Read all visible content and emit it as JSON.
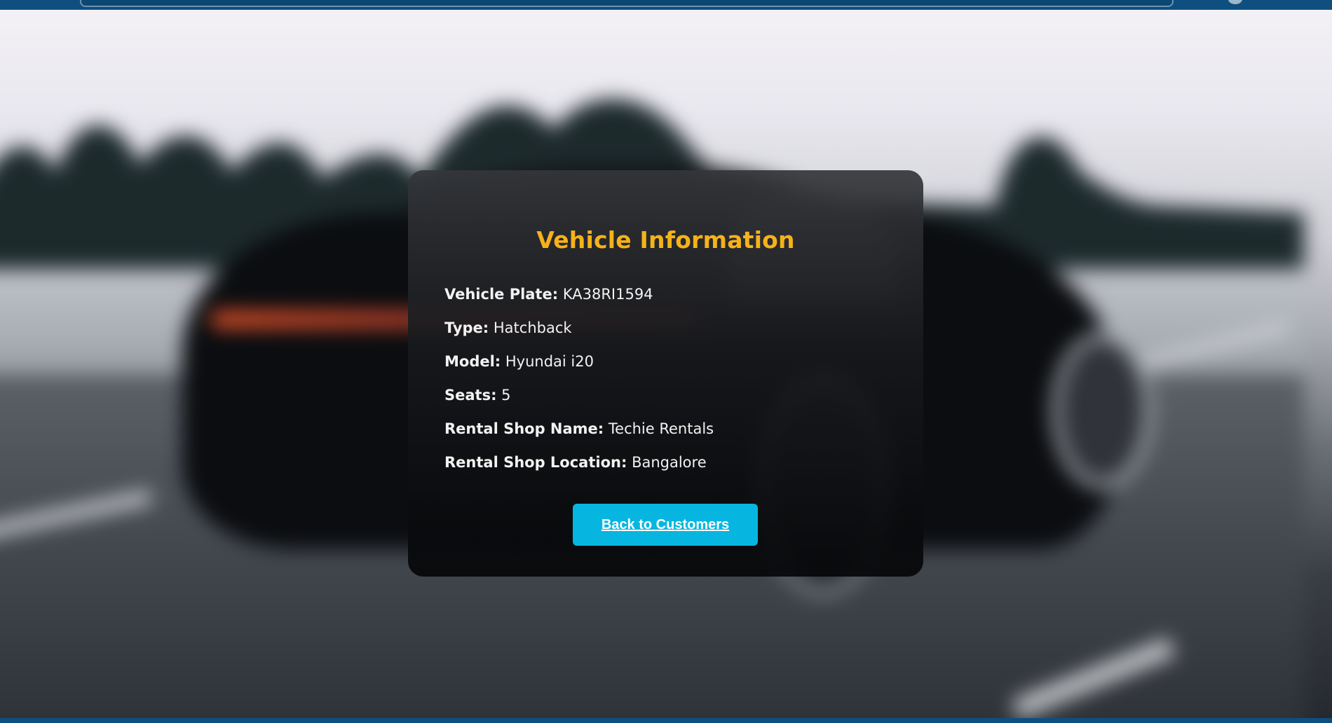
{
  "card": {
    "title": "Vehicle Information",
    "fields": [
      {
        "label": "Vehicle Plate:",
        "value": "KA38RI1594"
      },
      {
        "label": "Type:",
        "value": "Hatchback"
      },
      {
        "label": "Model:",
        "value": "Hyundai i20"
      },
      {
        "label": "Seats:",
        "value": "5"
      },
      {
        "label": "Rental Shop Name:",
        "value": "Techie Rentals"
      },
      {
        "label": "Rental Shop Location:",
        "value": "Bangalore"
      }
    ],
    "back_button_label": "Back to Customers"
  },
  "colors": {
    "title": "#f5b21a",
    "button": "#07b6e0",
    "nav_bar": "#0e4f80"
  }
}
